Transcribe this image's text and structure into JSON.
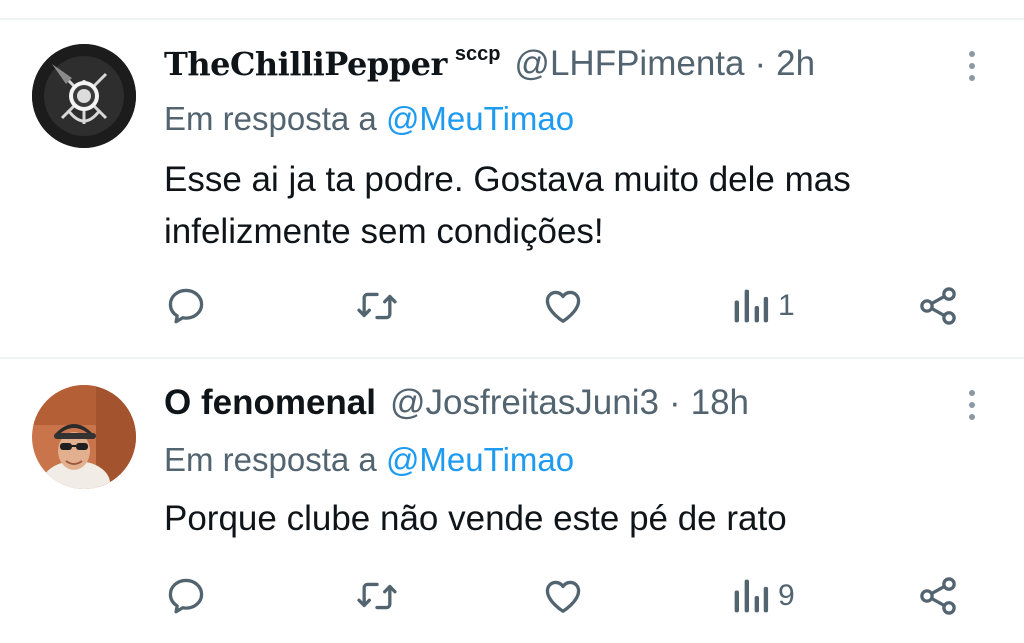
{
  "replies": [
    {
      "display_name": "TheChilliPepper",
      "name_tag": "sccp",
      "handle": "@LHFPimenta",
      "separator": "·",
      "time": "2h",
      "reply_prefix": "Em resposta a",
      "reply_mention": "@MeuTimao",
      "text_lines": [
        "Esse ai ja ta podre. Gostava muito dele mas",
        "infelizmente sem condições!"
      ],
      "views": "1"
    },
    {
      "display_name": "O fenomenal",
      "handle": "@JosfreitasJuni3",
      "separator": "·",
      "time": "18h",
      "reply_prefix": "Em resposta a",
      "reply_mention": "@MeuTimao",
      "text_lines": [
        "Porque clube não vende este pé de rato"
      ],
      "views": "9"
    }
  ],
  "icons": {
    "reply": "speech-bubble-icon",
    "retweet": "retweet-icon",
    "like": "heart-icon",
    "views": "bar-chart-icon",
    "share": "share-icon",
    "more": "more-vertical-icon"
  },
  "colors": {
    "text": "#0f1419",
    "secondary": "#536471",
    "link": "#1d9bf0",
    "divider": "#eff3f4"
  }
}
